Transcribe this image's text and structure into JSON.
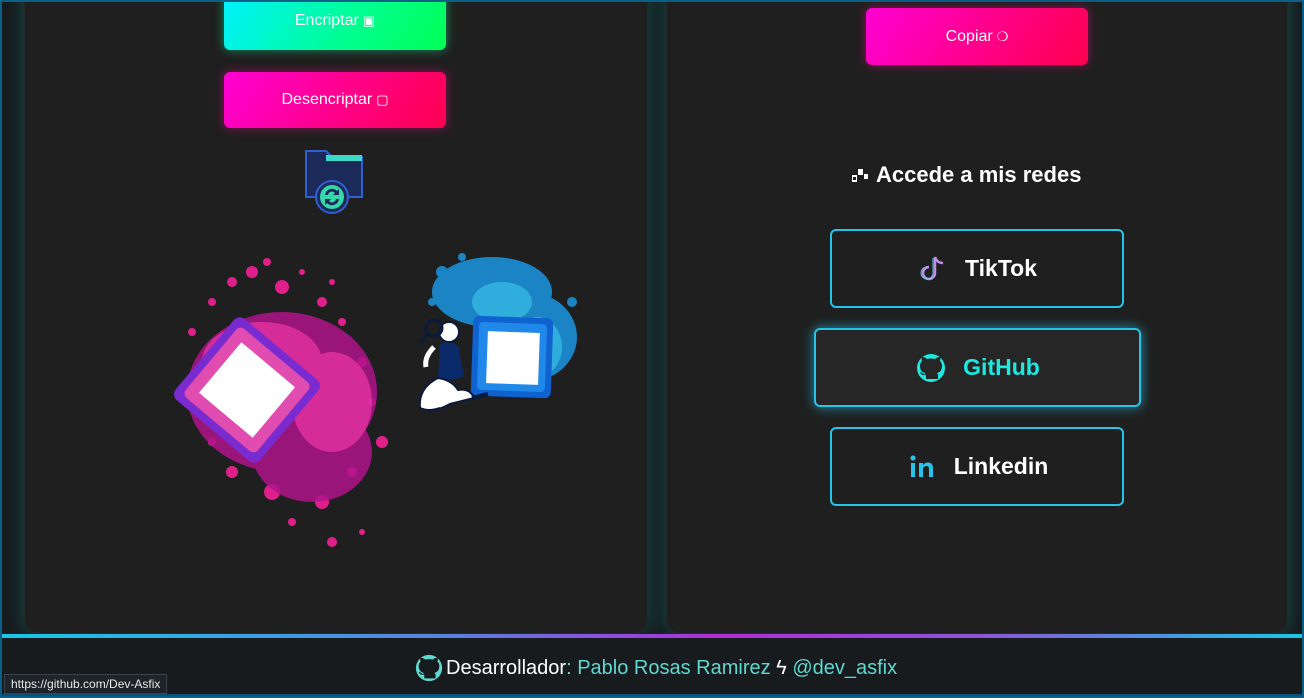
{
  "left_panel": {
    "encrypt_label": "Encriptar",
    "encrypt_glyph": "▣",
    "decrypt_label": "Desencriptar",
    "decrypt_glyph": "▢",
    "folder_icon": "folder-refresh-icon",
    "illustration": "search-person-illustration"
  },
  "right_panel": {
    "copy_label": "Copiar",
    "copy_glyph": "❍",
    "social_title": "Accede a mis redes",
    "social_links": [
      {
        "label": "TikTok",
        "icon": "tiktok-icon"
      },
      {
        "label": "GitHub",
        "icon": "github-icon"
      },
      {
        "label": "Linkedin",
        "icon": "linkedin-icon"
      }
    ]
  },
  "footer": {
    "prefix": "Desarrollador",
    "separator": ":",
    "author": "Pablo Rosas Ramirez",
    "divider": "ϟ",
    "handle": "@dev_asfix"
  },
  "status_bar": {
    "url": "https://github.com/Dev-Asfix"
  },
  "colors": {
    "panel_bg": "#1f1f1f",
    "accent_cyan": "#27c3e8",
    "accent_teal": "#1de9e0",
    "gradient_green": "#00ff8c",
    "gradient_pink": "#ff0080"
  }
}
